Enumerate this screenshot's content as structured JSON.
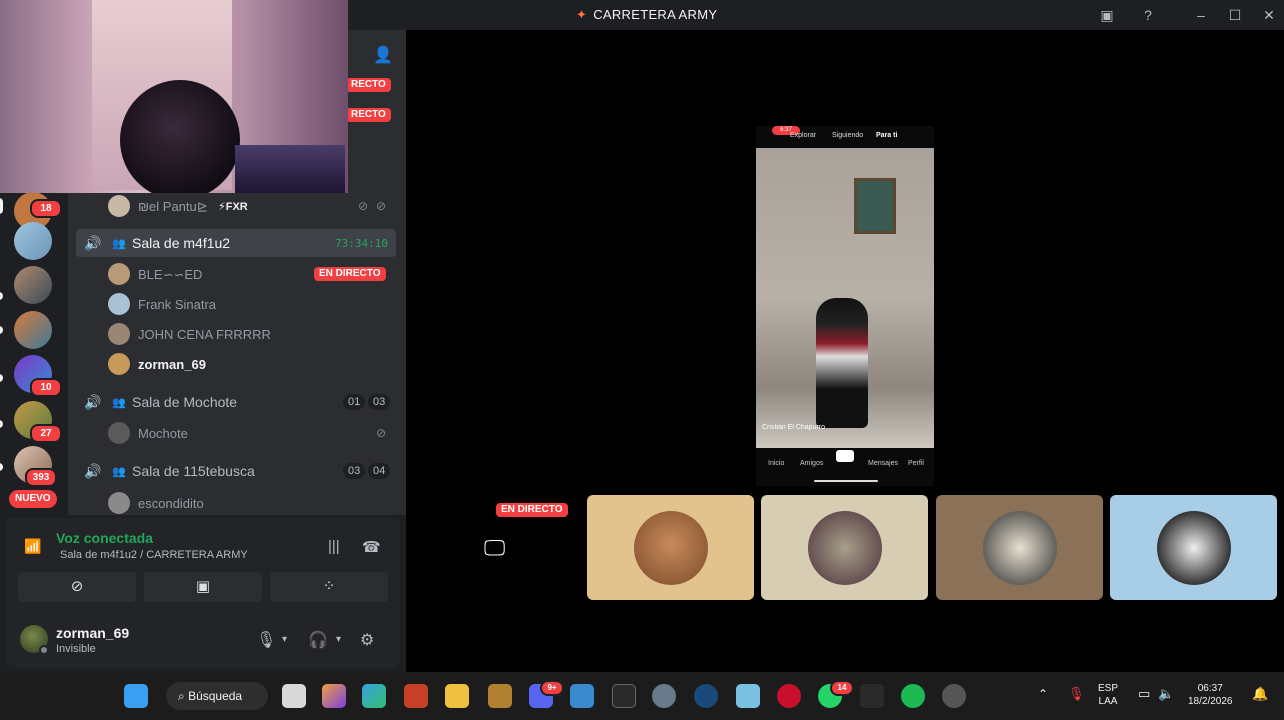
{
  "window": {
    "title": "CARRETERA ARMY"
  },
  "servers": {
    "badges": [
      "18",
      "10",
      "27",
      "393"
    ],
    "new_label": "NUEVO"
  },
  "channels": {
    "live_label": "EN DIRECTO",
    "partial_live": [
      "RECTO",
      "RECTO"
    ],
    "top_user": {
      "name": "₪el Pantu⊵",
      "tag": "⚡FXR"
    },
    "sala1": {
      "name": "Sala de m4f1u2",
      "timer": "73:34:10",
      "members": [
        {
          "name": "BLE∽∽ED",
          "live": true
        },
        {
          "name": "Frank Sinatra",
          "live": false
        },
        {
          "name": "JOHN CENA FRRRRR",
          "live": false
        },
        {
          "name": "zorman_69",
          "live": false
        }
      ]
    },
    "sala2": {
      "name": "Sala de Mochote",
      "count_a": "01",
      "count_b": "03",
      "members": [
        "Mochote"
      ]
    },
    "sala3": {
      "name": "Sala de 115tebusca",
      "count_a": "03",
      "count_b": "04",
      "members": [
        "escondidito"
      ]
    }
  },
  "voice": {
    "title": "Voz conectada",
    "subtitle": "Sala de m4f1u2 / CARRETERA ARMY"
  },
  "user": {
    "name": "zorman_69",
    "status": "Invisible"
  },
  "stream": {
    "phone": {
      "status_time": "6:37",
      "tabs": [
        "Explorar",
        "Siguiendo",
        "Para ti"
      ],
      "caption": "Cristian El Chapurro",
      "nav": [
        "Inicio",
        "Amigos",
        "",
        "Mensajes",
        "Perfil"
      ]
    },
    "live_label": "EN DIRECTO"
  },
  "taskbar": {
    "search": "Búsqueda",
    "whatsapp_badge": "14",
    "discord_badge": "9+",
    "lang_top": "ESP",
    "lang_bottom": "LAA",
    "time": "06:37",
    "date": "18/2/2026"
  },
  "colors": {
    "green": "#23a55a",
    "red": "#f23f42",
    "bg": "#1e1f22",
    "panel": "#2b2d31"
  }
}
